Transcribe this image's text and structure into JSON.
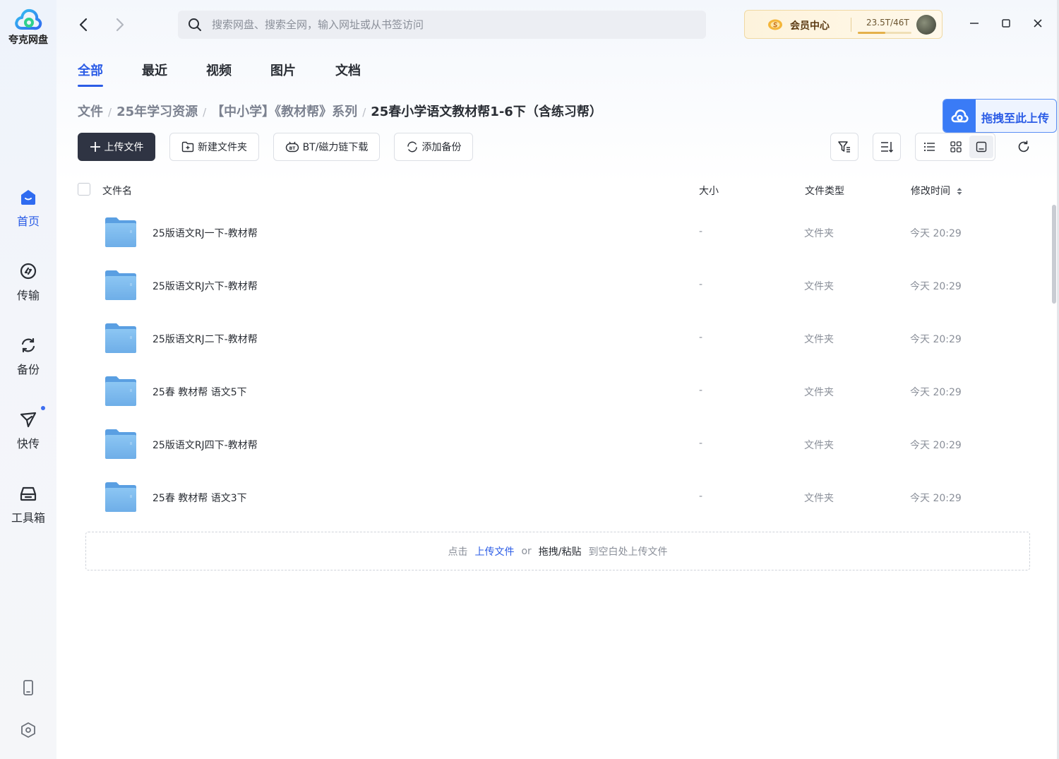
{
  "app": {
    "logo_text": "夸克网盘"
  },
  "sidebar": {
    "items": [
      {
        "label": "首页",
        "icon": "home-icon"
      },
      {
        "label": "传输",
        "icon": "transfer-icon"
      },
      {
        "label": "备份",
        "icon": "backup-icon"
      },
      {
        "label": "快传",
        "icon": "quick-send-icon"
      },
      {
        "label": "工具箱",
        "icon": "toolbox-icon"
      }
    ],
    "bottom": [
      {
        "icon": "phone-icon"
      },
      {
        "icon": "settings-icon"
      }
    ]
  },
  "search": {
    "placeholder": "搜索网盘、搜索全网，输入网址或从书签访问"
  },
  "vip": {
    "label": "会员中心",
    "storage": "23.5T/46T",
    "storage_used_fraction": 0.51
  },
  "tabs": [
    "全部",
    "最近",
    "视频",
    "图片",
    "文档"
  ],
  "active_tab": "全部",
  "breadcrumb": {
    "items": [
      "文件",
      "25年学习资源",
      "【中小学】《教材帮》系列"
    ],
    "current": "25春小学语文教材帮1-6下（含练习帮）"
  },
  "drag_upload_label": "拖拽至此上传",
  "toolbar": {
    "upload": "上传文件",
    "new_folder": "新建文件夹",
    "bt_download": "BT/磁力链下载",
    "add_backup": "添加备份"
  },
  "table": {
    "headers": {
      "name": "文件名",
      "size": "大小",
      "type": "文件类型",
      "modified": "修改时间"
    },
    "rows": [
      {
        "name": "25版语文RJ一下-教材帮",
        "size": "-",
        "type": "文件夹",
        "modified": "今天 20:29"
      },
      {
        "name": "25版语文RJ六下-教材帮",
        "size": "-",
        "type": "文件夹",
        "modified": "今天 20:29"
      },
      {
        "name": "25版语文RJ二下-教材帮",
        "size": "-",
        "type": "文件夹",
        "modified": "今天 20:29"
      },
      {
        "name": "25春 教材帮 语文5下",
        "size": "-",
        "type": "文件夹",
        "modified": "今天 20:29"
      },
      {
        "name": "25版语文RJ四下-教材帮",
        "size": "-",
        "type": "文件夹",
        "modified": "今天 20:29"
      },
      {
        "name": "25春 教材帮 语文3下",
        "size": "-",
        "type": "文件夹",
        "modified": "今天 20:29"
      }
    ]
  },
  "dropzone": {
    "prefix": "点击",
    "link": "上传文件",
    "or": "or",
    "strong": "拖拽/粘贴",
    "suffix": "到空白处上传文件"
  },
  "colors": {
    "accent": "#2b5ce6",
    "folder": "#7fb8ec",
    "primary_button": "#2f3443"
  }
}
